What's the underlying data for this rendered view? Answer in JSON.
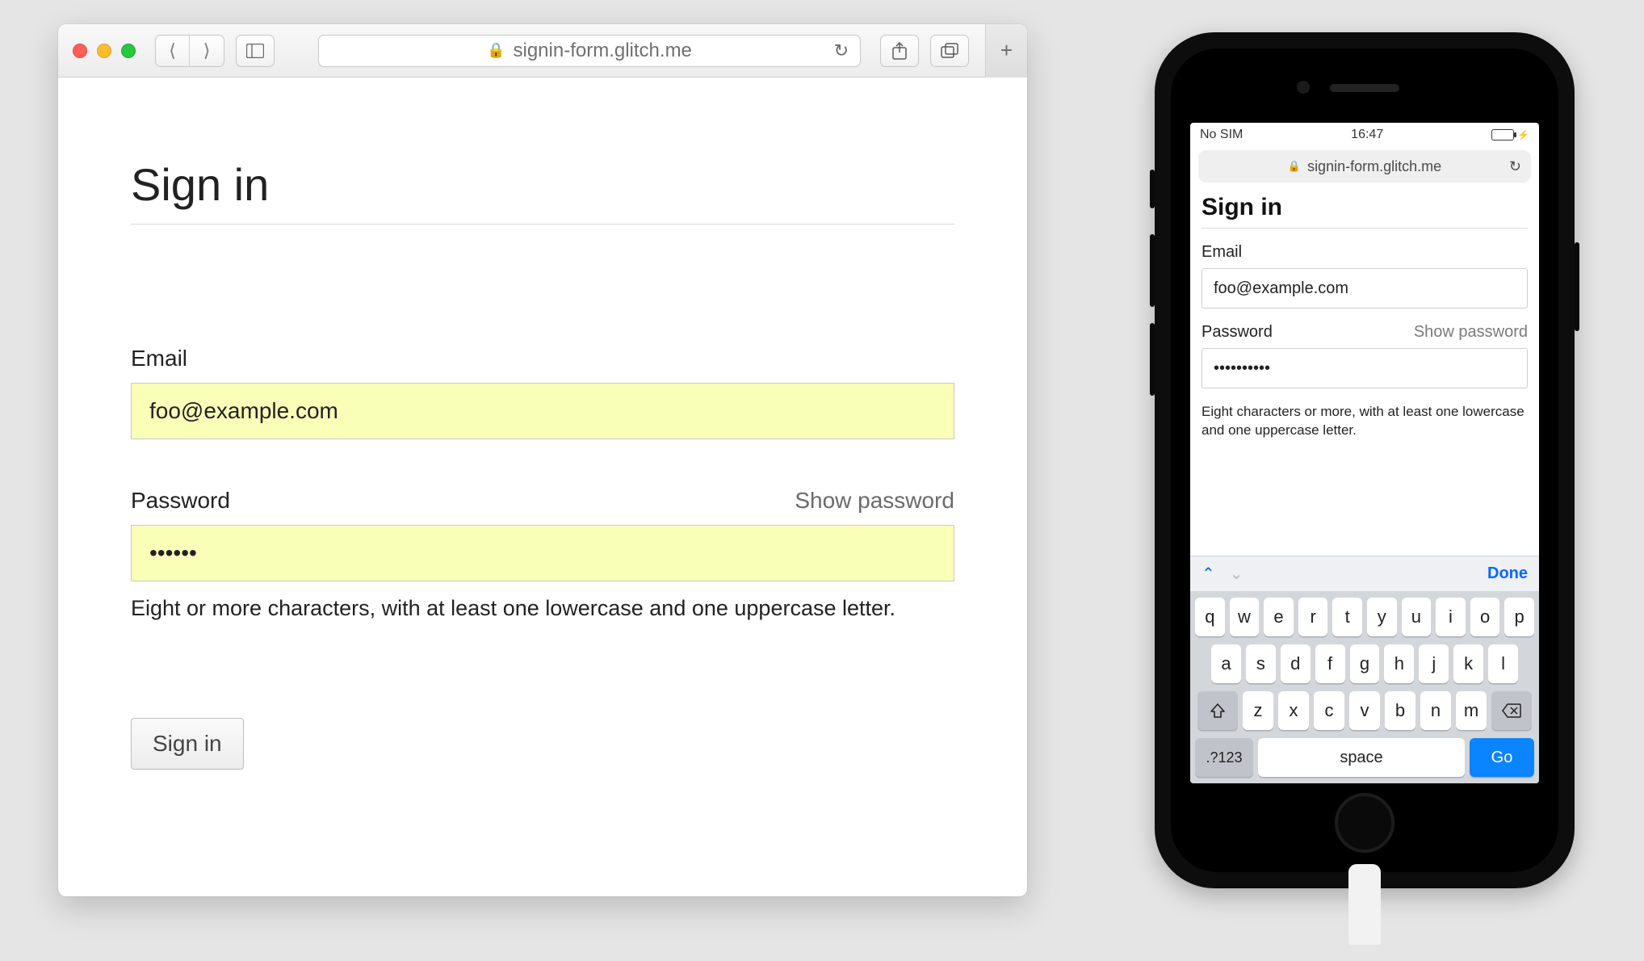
{
  "desktop": {
    "url_display": "signin-form.glitch.me",
    "page_title": "Sign in",
    "email": {
      "label": "Email",
      "value": "foo@example.com"
    },
    "password": {
      "label": "Password",
      "show_toggle": "Show password",
      "value": "••••••",
      "hint": "Eight or more characters, with at least one lowercase and one uppercase letter."
    },
    "submit_label": "Sign in"
  },
  "mobile": {
    "status": {
      "carrier": "No SIM",
      "time": "16:47"
    },
    "url_display": "signin-form.glitch.me",
    "page_title": "Sign in",
    "email": {
      "label": "Email",
      "value": "foo@example.com"
    },
    "password": {
      "label": "Password",
      "show_toggle": "Show password",
      "value": "••••••••••",
      "hint": "Eight characters or more, with at least one lowercase and one uppercase letter."
    },
    "keyboard": {
      "done": "Done",
      "rows": [
        [
          "q",
          "w",
          "e",
          "r",
          "t",
          "y",
          "u",
          "i",
          "o",
          "p"
        ],
        [
          "a",
          "s",
          "d",
          "f",
          "g",
          "h",
          "j",
          "k",
          "l"
        ],
        [
          "z",
          "x",
          "c",
          "v",
          "b",
          "n",
          "m"
        ]
      ],
      "num_key": ".?123",
      "space": "space",
      "go": "Go"
    }
  }
}
